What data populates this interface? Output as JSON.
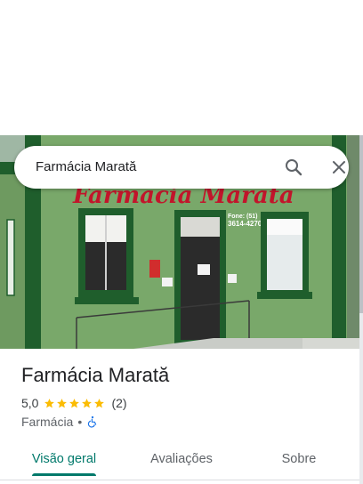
{
  "search": {
    "query": "Farmácia Marată"
  },
  "photo": {
    "sign_text": "Farmácia Marată",
    "phone_label": "Fone: (51)",
    "phone_number": "3614-4270"
  },
  "place": {
    "name": "Farmácia Marată",
    "rating": "5,0",
    "rating_stars": 5,
    "reviews_count": "(2)",
    "category": "Farmácia",
    "separator": "•"
  },
  "tabs": [
    {
      "label": "Visão geral",
      "active": true
    },
    {
      "label": "Avaliações",
      "active": false
    },
    {
      "label": "Sobre",
      "active": false
    }
  ],
  "colors": {
    "accent": "#00796b",
    "star": "#fbbc04",
    "access": "#1a73e8",
    "wall": "#79a86a",
    "trim": "#1f5e2c",
    "sign": "#c2152b"
  }
}
